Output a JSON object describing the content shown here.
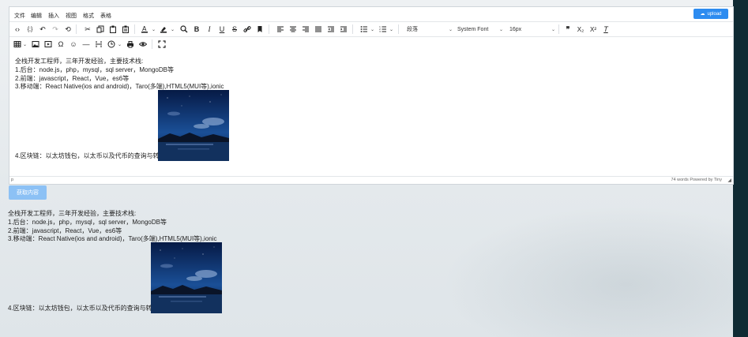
{
  "menubar": {
    "items": [
      "文件",
      "编辑",
      "插入",
      "视图",
      "格式",
      "表格"
    ],
    "upload_label": "upload"
  },
  "toolbar": {
    "block_format": "段落",
    "font_family": "System Font",
    "font_size": "16px"
  },
  "content": {
    "lines": [
      "全栈开发工程师，三年开发经验，主要技术栈:",
      "1.后台：node.js，php，mysql，sql server，MongoDB等",
      "2.前端：javascript，React，Vue，es6等",
      "3.移动端：React Native(ios and android)，Taro(多端),HTML5(MUI等),ionic",
      "4.区块链：以太坊钱包，以太币以及代币的查询与转账"
    ]
  },
  "statusbar": {
    "path": "p",
    "word_count": "74 words",
    "powered_by": "Powered by Tiny"
  },
  "get_content_button": "获取内容",
  "colors": {
    "upload_button": "#2d8cf0",
    "get_content_button": "#8cc1f5",
    "image_sky": "#0b2a66"
  }
}
